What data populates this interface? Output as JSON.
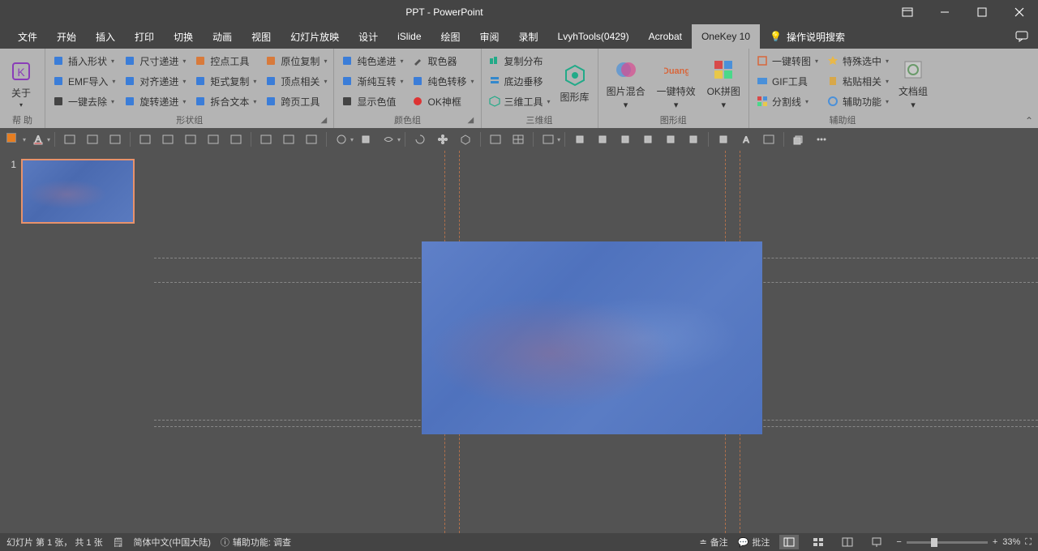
{
  "title": "PPT  -  PowerPoint",
  "tabs": [
    "文件",
    "开始",
    "插入",
    "打印",
    "切换",
    "动画",
    "视图",
    "幻灯片放映",
    "设计",
    "iSlide",
    "绘图",
    "审阅",
    "录制",
    "LvyhTools(0429)",
    "Acrobat",
    "OneKey 10"
  ],
  "active_tab": "OneKey 10",
  "search_placeholder": "操作说明搜索",
  "ribbon": {
    "help": {
      "about": "关于",
      "label": "帮 助"
    },
    "shape": {
      "label": "形状组",
      "c1": [
        "插入形状",
        "EMF导入",
        "一键去除"
      ],
      "c2": [
        "尺寸递进",
        "对齐递进",
        "旋转递进"
      ],
      "c3": [
        "控点工具",
        "矩式复制",
        "拆合文本"
      ],
      "c4": [
        "原位复制",
        "顶点相关",
        "跨页工具"
      ]
    },
    "color": {
      "label": "颜色组",
      "c1": [
        "纯色递进",
        "渐纯互转",
        "显示色值"
      ],
      "c2": [
        "取色器",
        "纯色转移",
        "OK神框"
      ]
    },
    "three_d": {
      "label": "三维组",
      "c1": [
        "复制分布",
        "底边垂移",
        "三维工具"
      ],
      "gallery": "图形库"
    },
    "graphic": {
      "label": "图形组",
      "mix": "图片混合",
      "fx": "一键特效",
      "puzzle": "OK拼图"
    },
    "aux": {
      "label": "辅助组",
      "c1": [
        "一键转图",
        "GIF工具",
        "分割线"
      ],
      "c2": [
        "特殊选中",
        "粘贴相关",
        "辅助功能"
      ],
      "docgroup": "文档组"
    }
  },
  "thumb_number": "1",
  "status": {
    "slide_info": "幻灯片 第 1 张， 共 1 张",
    "lang": "简体中文(中国大陆)",
    "access": "辅助功能: 调查",
    "notes": "备注",
    "comments": "批注",
    "zoom": "33%"
  }
}
